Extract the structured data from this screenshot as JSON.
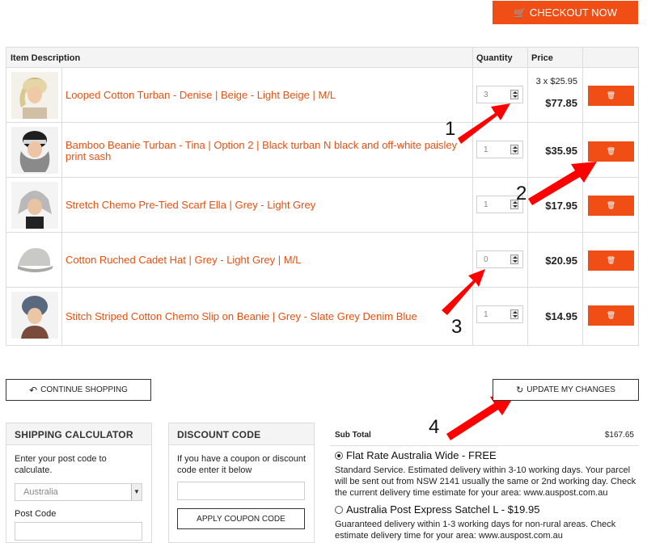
{
  "checkout": {
    "label": "CHECKOUT NOW",
    "icon": "cart-icon"
  },
  "table": {
    "headers": {
      "description": "Item Description",
      "quantity": "Quantity",
      "price": "Price"
    },
    "rows": [
      {
        "name": "Looped Cotton Turban - Denise | Beige - Light Beige | M/L",
        "qty": "3",
        "calc": "3 x $25.95",
        "price": "$77.85"
      },
      {
        "name": "Bamboo Beanie Turban - Tina | Option 2 | Black turban N black and off-white paisley print sash",
        "qty": "1",
        "calc": "",
        "price": "$35.95"
      },
      {
        "name": "Stretch Chemo Pre-Tied Scarf Ella | Grey - Light Grey",
        "qty": "1",
        "calc": "",
        "price": "$17.95"
      },
      {
        "name": "Cotton Ruched Cadet Hat | Grey - Light Grey | M/L",
        "qty": "0",
        "calc": "",
        "price": "$20.95"
      },
      {
        "name": "Stitch Striped Cotton Chemo Slip on Beanie | Grey - Slate Grey Denim Blue",
        "qty": "1",
        "calc": "",
        "price": "$14.95"
      }
    ]
  },
  "annotations": [
    "1",
    "2",
    "3",
    "4"
  ],
  "buttons": {
    "continue": "CONTINUE SHOPPING",
    "update": "UPDATE MY CHANGES",
    "apply_coupon": "APPLY COUPON CODE"
  },
  "shipping": {
    "title": "SHIPPING CALCULATOR",
    "text": "Enter your post code to calculate.",
    "country": "Australia",
    "postcode_label": "Post Code"
  },
  "discount": {
    "title": "DISCOUNT CODE",
    "text": "If you have a coupon or discount code enter it below"
  },
  "summary": {
    "subtotal_label": "Sub Total",
    "subtotal_value": "$167.65",
    "options": [
      {
        "title": "Flat Rate Australia Wide - FREE",
        "selected": true,
        "desc": "Standard Service. Estimated delivery within 3-10 working days. Your parcel will be sent out from NSW 2141 usually the same or 2nd working day. Check the current delivery time estimate for your area: www.auspost.com.au"
      },
      {
        "title": "Australia Post Express Satchel L - $19.95",
        "selected": false,
        "desc": "Guaranteed delivery within 1-3 working days for non-rural areas. Check estimate delivery time for your area: www.auspost.com.au"
      }
    ]
  },
  "colors": {
    "accent": "#f04e14",
    "link": "#e65111",
    "annotation": "#ff0000"
  }
}
